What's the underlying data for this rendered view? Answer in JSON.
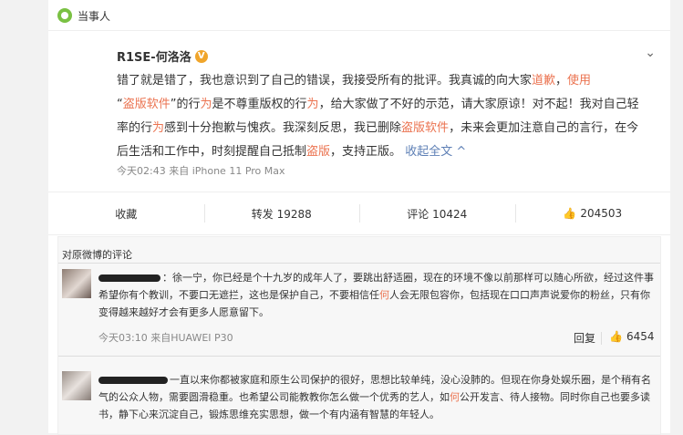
{
  "card": {
    "tag_label": "当事人"
  },
  "post": {
    "author": "R1SE-何洛洛",
    "badge": "V",
    "more_icon": "⌄",
    "text": {
      "p1": "错了就是错了，我也意识到了自己的错误，我接受所有的批评。我真诚的向大家",
      "h1": "道歉",
      "p2": "，",
      "h2": "使用",
      "p3": "“",
      "h3": "盗版软件",
      "p4": "”的行",
      "h4": "为",
      "p5": "是不尊重版权的行",
      "h5": "为",
      "p6": "，给大家做了不好的示范，请大家原谅！对不起！我对自己轻率的行",
      "h6": "为",
      "p7": "感到十分抱歉与愧疚。我深刻反思，我已删除",
      "h7": "盗版软件",
      "p8": "，未来会更加注意自己的言行，在今后生活和工作中，时刻提醒自己抵制",
      "h8": "盗版",
      "p9": "，支持正版。",
      "collapse": "收起全文"
    },
    "meta": "今天02:43 来自 iPhone 11 Pro Max"
  },
  "actions": {
    "favorite": "收藏",
    "repost": "转发 19288",
    "comment": "评论 10424",
    "like_count": "204503"
  },
  "comments": {
    "title": "对原微博的评论",
    "items": [
      {
        "text_a": "：徐一宁，你已经是个十九岁的成年人了，要跳出舒适圈，现在的环境不像以前那样可以随心所欲，经过这件事希望你有个教训，不要口无遮拦，这也是保护自己，不要相信任",
        "highlight": "何",
        "text_b": "人会无限包容你，包括现在口口声声说爱你的粉丝，只有你变得越来越好才会有更多人愿意留下。",
        "meta": "今天03:10 来自HUAWEI P30",
        "reply": "回复",
        "likes": "6454"
      },
      {
        "text_a": "一直以来你都被家庭和原生公司保护的很好，思想比较单纯，没心没肺的。但现在你身处娱乐圈，是个稍有名气的公众人物，需要圆滑稳重。也希望公司能教教你怎么做一个优秀的艺人，如",
        "highlight": "何",
        "text_b": "公开发言、待人接物。同时你自己也要多读书，静下心来沉淀自己，锻炼思维充实思想，做一个有内涵有智慧的年轻人。"
      }
    ]
  }
}
